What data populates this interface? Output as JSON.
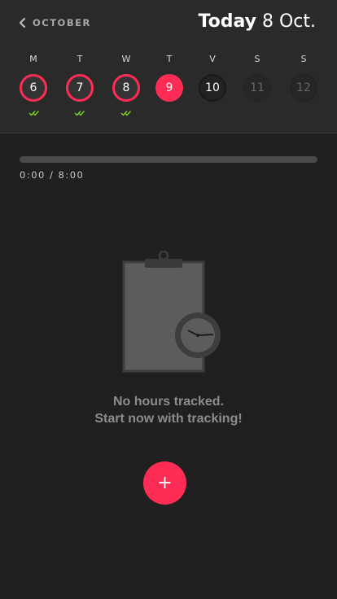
{
  "header": {
    "back_label": "OCTOBER",
    "today_bold": "Today",
    "today_date": "8 Oct."
  },
  "week": [
    {
      "letter": "M",
      "num": "6",
      "state": "past",
      "tracked": true
    },
    {
      "letter": "T",
      "num": "7",
      "state": "past",
      "tracked": true
    },
    {
      "letter": "W",
      "num": "8",
      "state": "past",
      "tracked": true
    },
    {
      "letter": "T",
      "num": "9",
      "state": "today",
      "tracked": false
    },
    {
      "letter": "V",
      "num": "10",
      "state": "upcoming",
      "tracked": false
    },
    {
      "letter": "S",
      "num": "11",
      "state": "future",
      "tracked": false
    },
    {
      "letter": "S",
      "num": "12",
      "state": "future",
      "tracked": false
    }
  ],
  "progress": {
    "readout": "0:00 / 8:00",
    "fraction": 0
  },
  "empty_state": {
    "title": "No hours tracked.",
    "subtitle": "Start now with tracking!"
  },
  "fab": {
    "label": "+"
  },
  "colors": {
    "accent": "#ff2d55",
    "check": "#7ed321"
  },
  "icons": {
    "back": "chevron-left-icon",
    "check": "double-check-icon",
    "illustration": "clipboard-clock-icon"
  }
}
